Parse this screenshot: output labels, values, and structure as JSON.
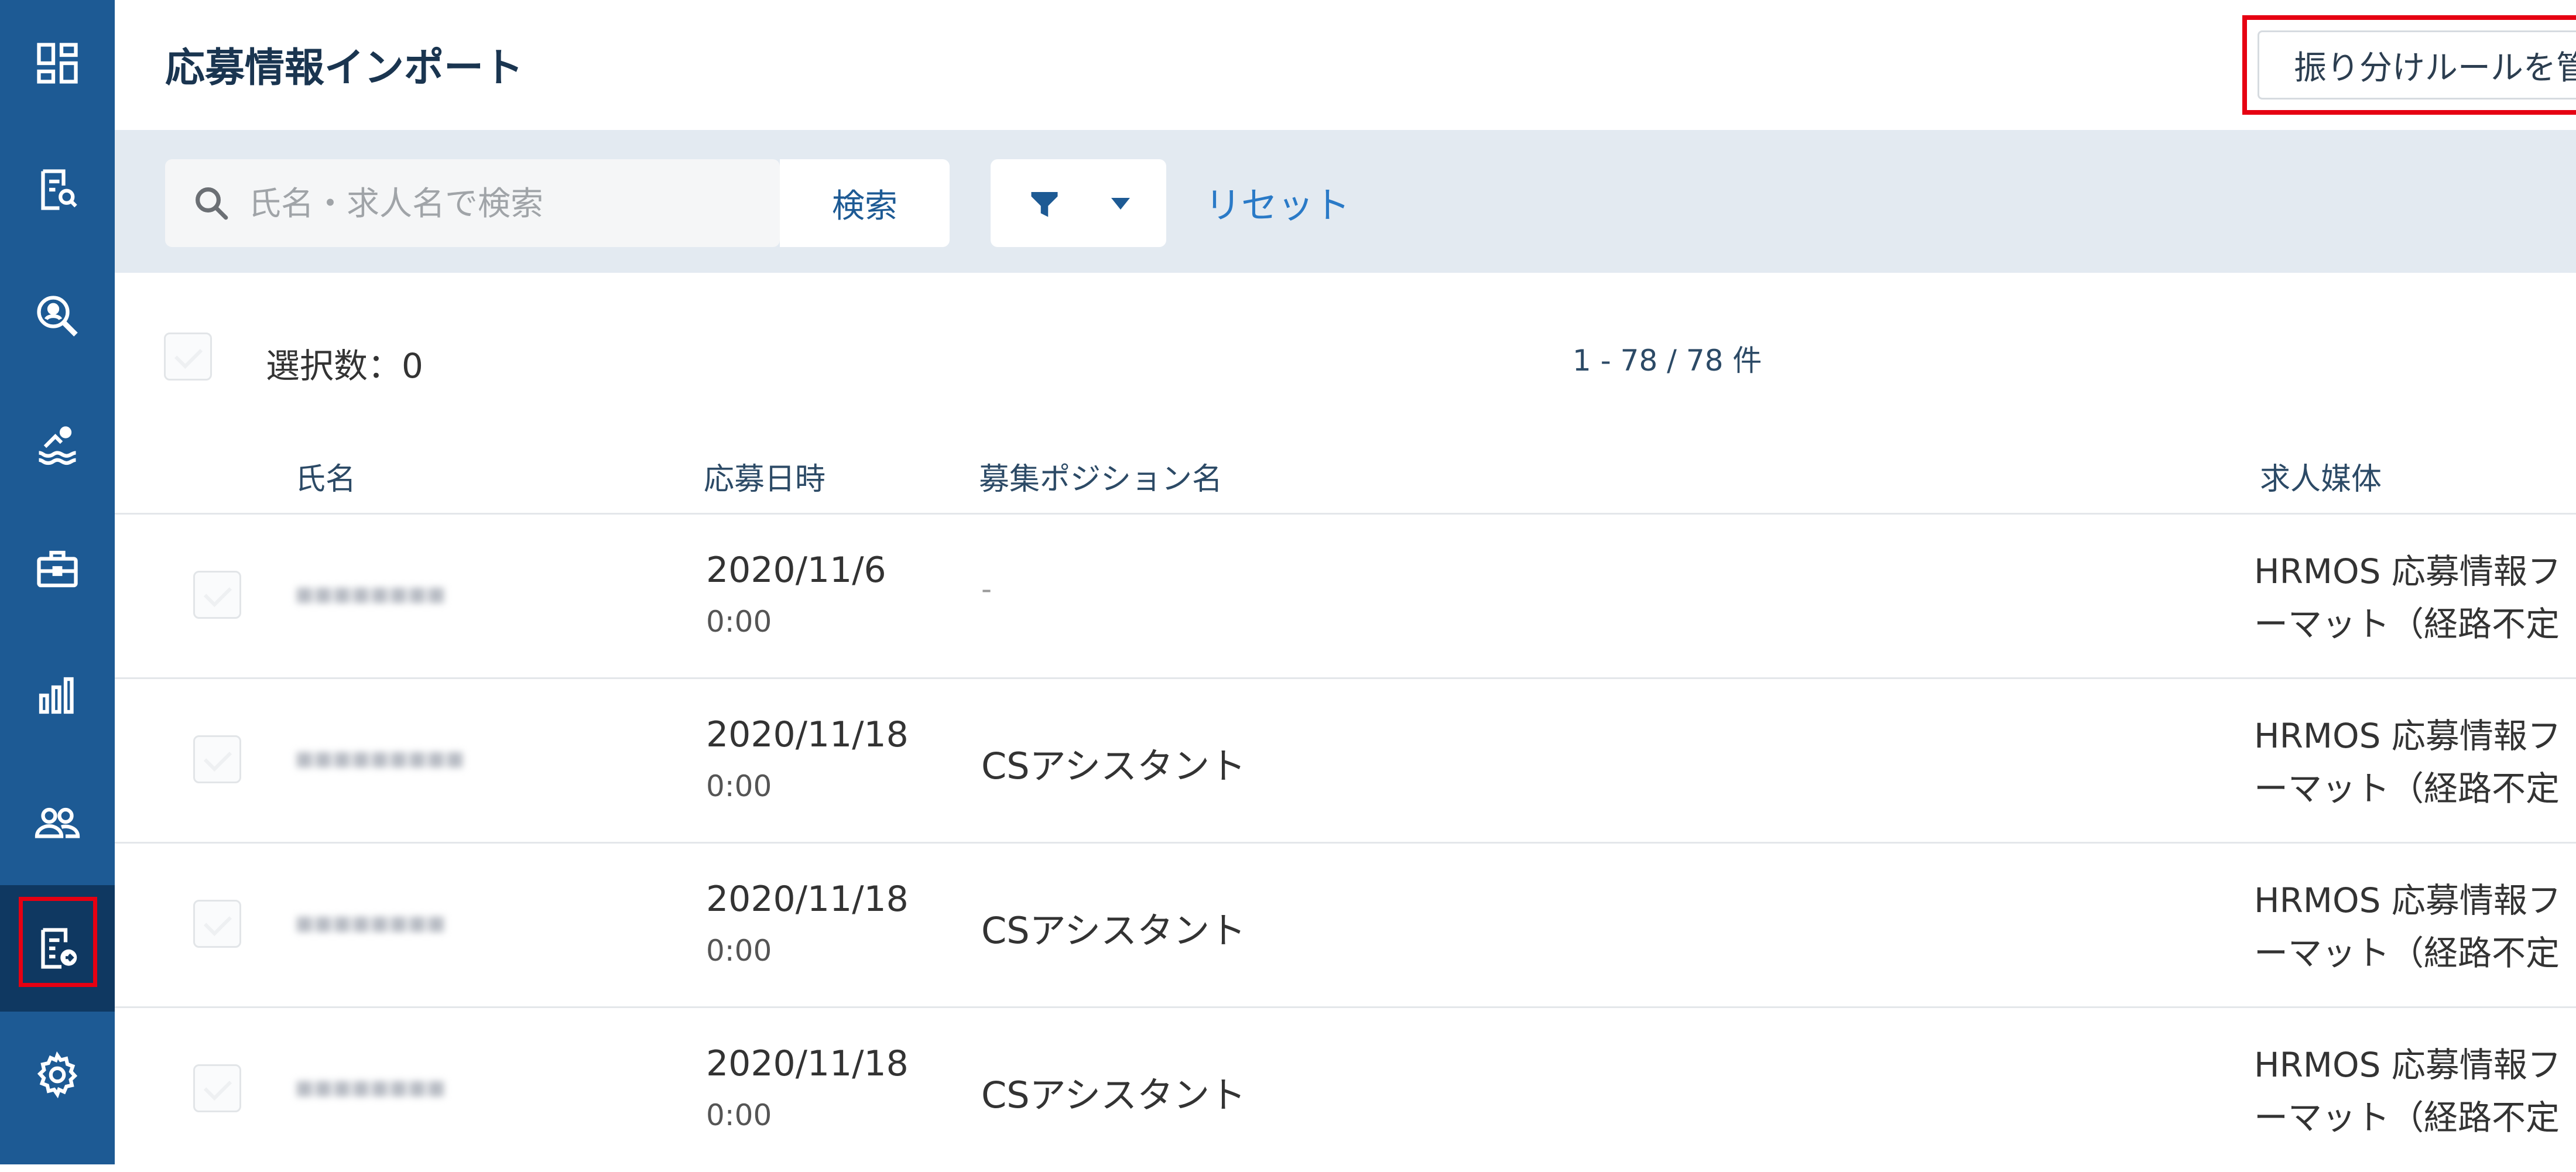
{
  "sidebar": {
    "items": [
      {
        "icon": "dashboard-icon",
        "active": false
      },
      {
        "icon": "document-search-icon",
        "active": false
      },
      {
        "icon": "magnify-person-icon",
        "active": false
      },
      {
        "icon": "swimmer-icon",
        "active": false
      },
      {
        "icon": "briefcase-icon",
        "active": false
      },
      {
        "icon": "bar-chart-icon",
        "active": false
      },
      {
        "icon": "people-icon",
        "active": false
      },
      {
        "icon": "document-import-icon",
        "active": true
      },
      {
        "icon": "gear-icon",
        "active": false
      }
    ],
    "colors": {
      "background": "#1d5a94",
      "active": "#0f3861",
      "highlight": "#e60012"
    }
  },
  "header": {
    "title": "応募情報インポート",
    "rules_button_label": "振り分けルールを管理"
  },
  "filter": {
    "search_placeholder": "氏名・求人名で検索",
    "search_button_label": "検索",
    "reset_label": "リセット"
  },
  "list": {
    "selected_count": "選択数：0",
    "pagination": "1 - 78 / 78 件",
    "columns": {
      "name": "氏名",
      "applied_at": "応募日時",
      "position": "募集ポジション名",
      "media": "求人媒体"
    },
    "rows": [
      {
        "date": "2020/11/6",
        "time": "0:00",
        "position": "-",
        "media_line1": "HRMOS 応募情報フ",
        "media_line2": "ーマット（経路不定"
      },
      {
        "date": "2020/11/18",
        "time": "0:00",
        "position": "CSアシスタント",
        "media_line1": "HRMOS 応募情報フ",
        "media_line2": "ーマット（経路不定"
      },
      {
        "date": "2020/11/18",
        "time": "0:00",
        "position": "CSアシスタント",
        "media_line1": "HRMOS 応募情報フ",
        "media_line2": "ーマット（経路不定"
      },
      {
        "date": "2020/11/18",
        "time": "0:00",
        "position": "CSアシスタント",
        "media_line1": "HRMOS 応募情報フ",
        "media_line2": "ーマット（経路不定"
      }
    ]
  }
}
